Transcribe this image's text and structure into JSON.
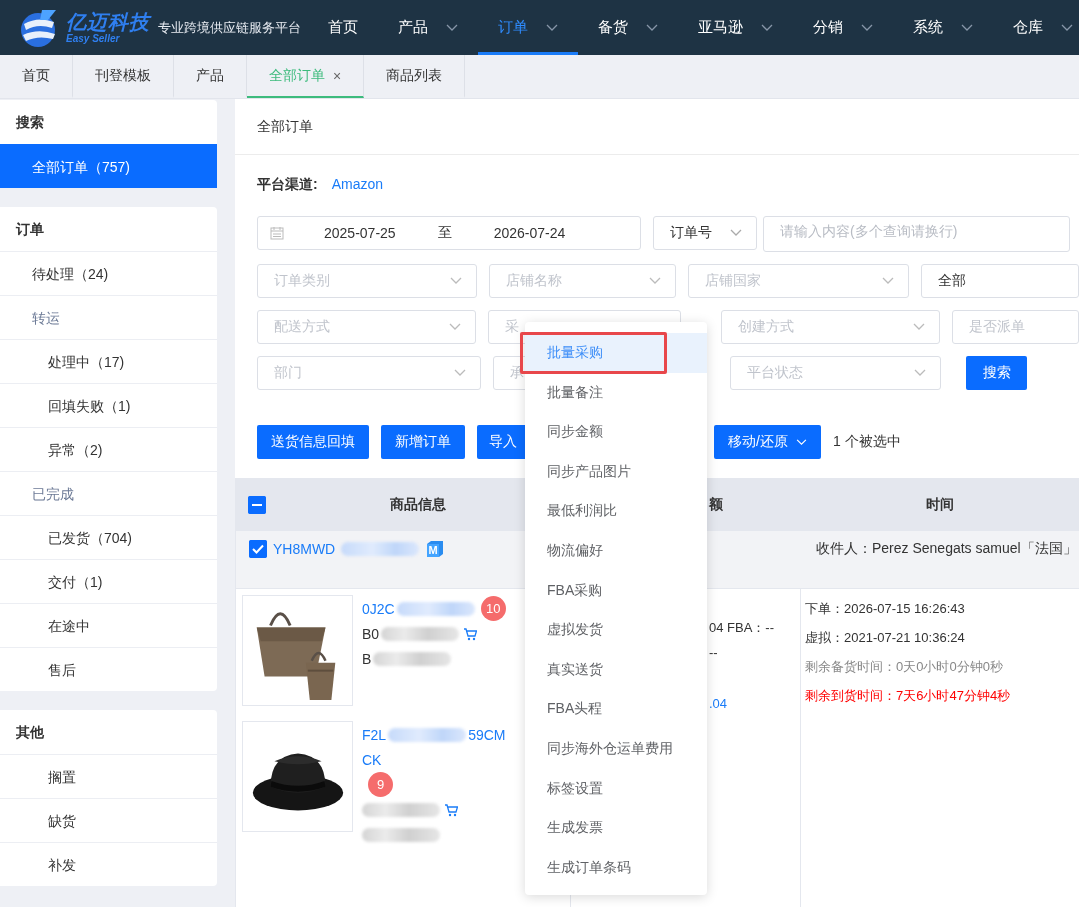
{
  "header": {
    "logo_text": "亿迈科技",
    "logo_subtitle": "Easy Seller",
    "slogan": "专业跨境供应链服务平台",
    "nav": [
      {
        "label": "首页",
        "has_menu": false,
        "selected": false
      },
      {
        "label": "产品",
        "has_menu": true,
        "selected": false
      },
      {
        "label": "订单",
        "has_menu": true,
        "selected": true
      },
      {
        "label": "备货",
        "has_menu": true,
        "selected": false
      },
      {
        "label": "亚马逊",
        "has_menu": true,
        "selected": false
      },
      {
        "label": "分销",
        "has_menu": true,
        "selected": false
      },
      {
        "label": "系统",
        "has_menu": true,
        "selected": false
      },
      {
        "label": "仓库",
        "has_menu": true,
        "selected": false
      }
    ]
  },
  "tabs": [
    {
      "label": "首页",
      "selected": false
    },
    {
      "label": "刊登模板",
      "selected": false
    },
    {
      "label": "产品",
      "selected": false
    },
    {
      "label": "全部订单",
      "selected": true,
      "close": "×"
    },
    {
      "label": "商品列表",
      "selected": false
    }
  ],
  "sidebar": {
    "groups": [
      {
        "title": "搜索",
        "items": [
          {
            "kind": "item",
            "label": "全部订单（757)",
            "selected": true
          }
        ]
      },
      {
        "title": "订单",
        "items": [
          {
            "kind": "item",
            "label": "待处理（24)",
            "selected": false
          },
          {
            "kind": "category",
            "label": "转运",
            "selected": false,
            "children": [
              {
                "kind": "subitem",
                "label": "处理中（17)",
                "selected": false
              },
              {
                "kind": "subitem",
                "label": "回填失败（1)",
                "selected": false
              },
              {
                "kind": "subitem",
                "label": "异常（2)",
                "selected": false
              }
            ]
          },
          {
            "kind": "category",
            "label": "已完成",
            "selected": false,
            "children": [
              {
                "kind": "subitem",
                "label": "已发货（704)",
                "selected": false
              },
              {
                "kind": "subitem",
                "label": "交付（1)",
                "selected": false
              },
              {
                "kind": "subitem",
                "label": "在途中",
                "selected": false
              },
              {
                "kind": "subitem",
                "label": "售后",
                "selected": false
              }
            ]
          }
        ]
      },
      {
        "title": "其他",
        "items": [
          {
            "kind": "subitem",
            "label": "搁置",
            "selected": false
          },
          {
            "kind": "subitem",
            "label": "缺货",
            "selected": false
          },
          {
            "kind": "subitem",
            "label": "补发",
            "selected": false
          }
        ]
      }
    ]
  },
  "panel": {
    "title": "全部订单",
    "channel_label": "平台渠道:",
    "channel": "Amazon",
    "date_from": "2025-07-25",
    "date_separator": "至",
    "date_to": "2026-07-24",
    "query_field": "订单号",
    "query_placeholder": "请输入内容(多个查询请换行)",
    "filter_rows": [
      [
        {
          "kind": "select",
          "placeholder": "订单类别",
          "caret": true
        },
        {
          "kind": "select",
          "placeholder": "店铺名称",
          "caret": true
        },
        {
          "kind": "select",
          "placeholder": "店铺国家",
          "caret": true
        },
        {
          "kind": "select",
          "value": "全部",
          "caret": false
        }
      ],
      [
        {
          "kind": "select",
          "placeholder": "配送方式",
          "caret": true
        },
        {
          "kind": "select",
          "placeholder": "采",
          "caret": false
        },
        {
          "kind": "select",
          "placeholder": "创建方式",
          "caret": true
        },
        {
          "kind": "select",
          "placeholder": "是否派单",
          "caret": false
        }
      ],
      [
        {
          "kind": "select",
          "placeholder": "部门",
          "caret": true
        },
        {
          "kind": "select",
          "placeholder": "承",
          "caret": false
        },
        {
          "kind": "select",
          "placeholder": "平台状态",
          "caret": true
        },
        {
          "kind": "button",
          "label": "搜索"
        }
      ]
    ],
    "buttons": [
      {
        "label": "送货信息回填",
        "has_menu": false
      },
      {
        "label": "新增订单",
        "has_menu": false
      },
      {
        "label": "导入",
        "has_menu": false
      },
      {
        "label": "移动/还原",
        "has_menu": true
      }
    ],
    "selection_text": "1 个被选中"
  },
  "table": {
    "header_partial": true,
    "columns": [
      {
        "label": "商品信息"
      },
      {
        "label": "额"
      },
      {
        "label": "时间"
      }
    ],
    "order": {
      "checked": true,
      "order_no": "YH8MWD",
      "marketplace_badge": "M",
      "recipient": "收件人：Perez Senegats samuel「法国」",
      "times": [
        {
          "kind": "normal",
          "text": "下单：2026-07-15 16:26:43"
        },
        {
          "kind": "normal",
          "text": "虚拟：2021-07-21 10:36:24"
        },
        {
          "kind": "muted",
          "text": "剩余备货时间：0天0小时0分钟0秒"
        },
        {
          "kind": "alert",
          "text": "剩余到货时间：7天6小时47分钟4秒"
        }
      ],
      "amounts": [
        {
          "kind": "text",
          "text": "04   FBA：--"
        },
        {
          "kind": "text",
          "text": "--"
        },
        {
          "kind": "link",
          "text": ".04"
        }
      ],
      "products": [
        {
          "kind": "picture",
          "lines": [
            {
              "kind": "link",
              "before": "0J2C",
              "blurred": true,
              "count": "10"
            },
            {
              "kind": "text",
              "before": "B0",
              "blurred": true,
              "cart": true
            },
            {
              "kind": "text",
              "before": "B",
              "blurred": true
            }
          ]
        },
        {
          "kind": "picture",
          "lines": [
            {
              "kind": "link",
              "before": "F2L",
              "blurred": true,
              "after": "59CM"
            },
            {
              "kind": "link",
              "before": "CK",
              "blurred": false
            },
            {
              "kind": "count",
              "count": "9"
            },
            {
              "kind": "text",
              "blurred": true,
              "cart": true
            },
            {
              "kind": "text",
              "blurred": true
            }
          ]
        }
      ]
    }
  },
  "menu": {
    "items": [
      {
        "label": "批量采购",
        "selected": true,
        "marked": true
      },
      {
        "label": "批量备注",
        "selected": false,
        "marked": false
      },
      {
        "label": "同步金额",
        "selected": false,
        "marked": false
      },
      {
        "label": "同步产品图片",
        "selected": false,
        "marked": false
      },
      {
        "label": "最低利润比",
        "selected": false,
        "marked": false
      },
      {
        "label": "物流偏好",
        "selected": false,
        "marked": false
      },
      {
        "label": "FBA采购",
        "selected": false,
        "marked": false
      },
      {
        "label": "虚拟发货",
        "selected": false,
        "marked": false
      },
      {
        "label": "真实送货",
        "selected": false,
        "marked": false
      },
      {
        "label": "FBA头程",
        "selected": false,
        "marked": false
      },
      {
        "label": "同步海外仓运单费用",
        "selected": false,
        "marked": false
      },
      {
        "label": "标签设置",
        "selected": false,
        "marked": false
      },
      {
        "label": "生成发票",
        "selected": false,
        "marked": false
      },
      {
        "label": "生成订单条码",
        "selected": false,
        "marked": false
      }
    ]
  }
}
